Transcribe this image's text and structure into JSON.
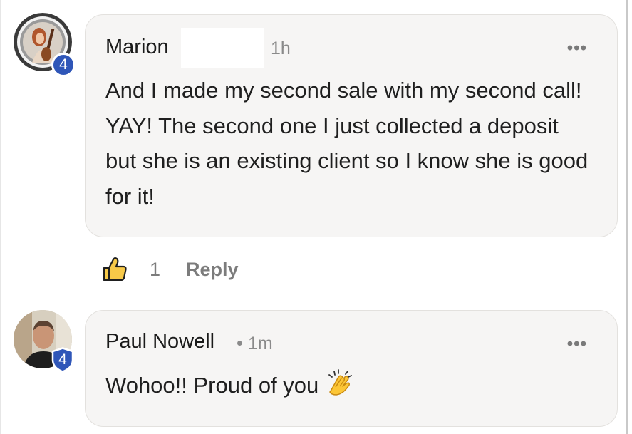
{
  "comments": [
    {
      "author": "Marion",
      "time": "1h",
      "level": "4",
      "body": "And I made my second sale with my second call! YAY! The second one I just collected a deposit but she is an existing client so I know she is good for it!",
      "more_label": "•••",
      "likes": "1",
      "reply_label": "Reply"
    },
    {
      "author": "Paul Nowell",
      "separator": "•",
      "time": "1m",
      "level": "4",
      "body": "Wohoo!! Proud of you",
      "more_label": "•••",
      "emoji": "clapping-hands-icon"
    }
  ],
  "colors": {
    "bubble_bg": "#f6f5f4",
    "badge_blue": "#2f56b8",
    "like_yellow": "#f7c948",
    "muted_text": "#7c7c7c"
  }
}
